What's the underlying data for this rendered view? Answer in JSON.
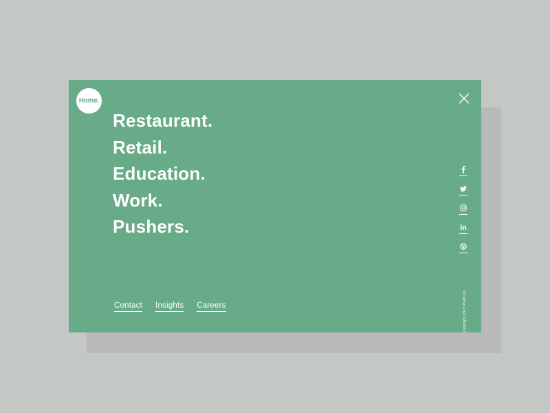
{
  "logo": {
    "label": "Home."
  },
  "nav": {
    "items": [
      {
        "label": "Restaurant."
      },
      {
        "label": "Retail."
      },
      {
        "label": "Education."
      },
      {
        "label": "Work."
      },
      {
        "label": "Pushers."
      }
    ]
  },
  "footer": {
    "links": [
      {
        "label": "Contact"
      },
      {
        "label": "Insights"
      },
      {
        "label": "Careers"
      }
    ]
  },
  "social": {
    "icons": [
      "facebook-icon",
      "twitter-icon",
      "instagram-icon",
      "linkedin-icon",
      "dribbble-icon"
    ]
  },
  "copyright": "Copyright 2017 Push Inc.",
  "colors": {
    "background": "#c4c8c4",
    "shadow": "#b9b9b9",
    "panel": "#67ab89",
    "text": "#ffffff"
  }
}
